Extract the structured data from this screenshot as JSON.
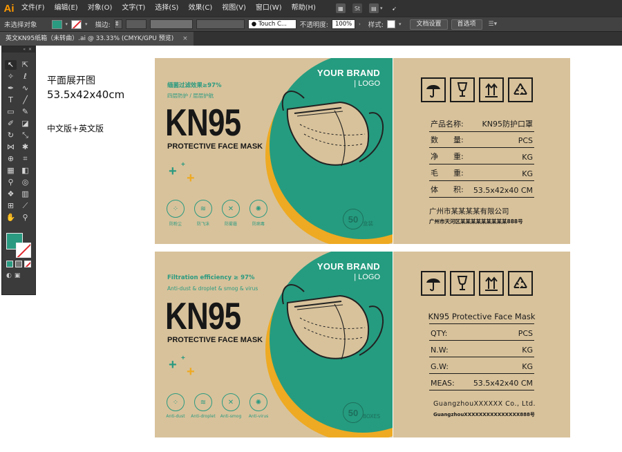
{
  "app": {
    "logo": "Ai",
    "menu": [
      "文件(F)",
      "编辑(E)",
      "对象(O)",
      "文字(T)",
      "选择(S)",
      "效果(C)",
      "视图(V)",
      "窗口(W)",
      "帮助(H)"
    ],
    "menu_icons": [
      "St"
    ]
  },
  "control": {
    "selection": "未选择对象",
    "stroke_label": "描边:",
    "brush": "Touch C...",
    "opacity_label": "不透明度:",
    "opacity_value": "100%",
    "style_label": "样式:",
    "doc_setup": "文档设置",
    "prefs": "首选项",
    "fill_color": "#2a9a80"
  },
  "tab": {
    "label": "英文KN95纸箱（未转曲）.ai @ 33.33% (CMYK/GPU 预览)",
    "close": "×"
  },
  "notes": {
    "title": "平面展开图",
    "size": "53.5x42x40cm",
    "version": "中文版+英文版"
  },
  "colors": {
    "kraft": "#d8c29b",
    "green": "#259c7f",
    "orange": "#eeaa22",
    "dark": "#171717"
  },
  "front_cn": {
    "brand": "YOUR BRAND",
    "logo": "| LOGO",
    "tag1": "缅菌过滤效果≥97%",
    "tag2": "四层防护 / 层层护航",
    "product": "KN95",
    "subtitle": "PROTECTIVE FACE MASK",
    "features": [
      "防粉尘",
      "防飞沫",
      "防雾霾",
      "防病毒"
    ],
    "count": "50",
    "count_unit": "盒装"
  },
  "side_cn": {
    "specs": [
      {
        "label": "产品名称:",
        "value": "KN95防护口罩"
      },
      {
        "label": "数　　量:",
        "value": "PCS"
      },
      {
        "label": "净　　重:",
        "value": "KG"
      },
      {
        "label": "毛　　重:",
        "value": "KG"
      },
      {
        "label": "体　　积:",
        "value": "53.5x42x40 CM"
      }
    ],
    "company": "广州市某某某某有限公司",
    "address": "广州市天河区某某某某某某某某某888号"
  },
  "front_en": {
    "brand": "YOUR BRAND",
    "logo": "| LOGO",
    "tag1": "Filtration efficiency ≥ 97%",
    "tag2": "Anti-dust & droplet & smog & virus",
    "product": "KN95",
    "subtitle": "PROTECTIVE FACE MASK",
    "features": [
      "Anti-dust",
      "Anti-droplet",
      "Anti-smog",
      "Anti-virus"
    ],
    "count": "50",
    "count_unit": "BOXES"
  },
  "side_en": {
    "title": "KN95 Protective Face Mask",
    "specs": [
      {
        "label": "QTY:",
        "value": "PCS"
      },
      {
        "label": "N.W:",
        "value": "KG"
      },
      {
        "label": "G.W:",
        "value": "KG"
      },
      {
        "label": "MEAS:",
        "value": "53.5x42x40  CM"
      }
    ],
    "company": "GuangzhouXXXXXX Co., Ltd.",
    "address": "GuangzhouXXXXXXXXXXXXXXX888号"
  }
}
